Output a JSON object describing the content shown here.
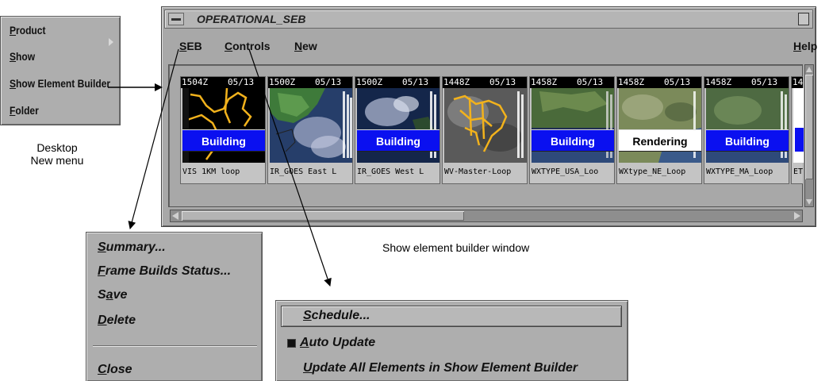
{
  "desktop_menu": {
    "items": [
      {
        "label": "Product",
        "mnemonic": "P",
        "rest": "roduct",
        "has_submenu": true
      },
      {
        "label": "Show",
        "mnemonic": "S",
        "rest": "how"
      },
      {
        "label": "Show Element Builder",
        "mnemonic": "S",
        "rest": "how Element Builder"
      },
      {
        "label": "Folder",
        "mnemonic": "F",
        "rest": "older"
      }
    ],
    "caption_line1": "Desktop",
    "caption_line2": "New menu"
  },
  "seb_window": {
    "title": "OPERATIONAL_SEB",
    "menubar": [
      {
        "label": "SEB",
        "mnemonic": "S",
        "rest": "EB"
      },
      {
        "label": "Controls",
        "mnemonic": "C",
        "rest": "ontrols"
      },
      {
        "label": "New",
        "mnemonic": "N",
        "rest": "ew"
      },
      {
        "label": "Help",
        "mnemonic": "H",
        "rest": "elp"
      }
    ],
    "elements": [
      {
        "time": "1504Z",
        "date": "05/13",
        "status": "Building",
        "name": "VIS 1KM  loop"
      },
      {
        "time": "1500Z",
        "date": "05/13",
        "status": "",
        "name": "IR_GOES East L"
      },
      {
        "time": "1500Z",
        "date": "05/13",
        "status": "Building",
        "name": "IR_GOES West L"
      },
      {
        "time": "1448Z",
        "date": "05/13",
        "status": "",
        "name": "WV-Master-Loop"
      },
      {
        "time": "1458Z",
        "date": "05/13",
        "status": "Building",
        "name": "WXTYPE_USA_Loo"
      },
      {
        "time": "1458Z",
        "date": "05/13",
        "status": "Rendering",
        "name": "WXtype_NE_Loop"
      },
      {
        "time": "1458Z",
        "date": "05/13",
        "status": "Building",
        "name": "WXTYPE_MA_Loop"
      },
      {
        "time": "14",
        "date": "",
        "status": "",
        "name": "ET"
      }
    ],
    "caption": "Show element builder window"
  },
  "seb_menu": {
    "items": [
      {
        "label": "Summary...",
        "mnemonic": "S",
        "rest": "ummary..."
      },
      {
        "label": "Frame Builds Status...",
        "mnemonic": "F",
        "rest": "rame Builds Status..."
      },
      {
        "label": "Save",
        "prefix": "S",
        "mnemonic": "a",
        "rest": "ve"
      },
      {
        "label": "Delete",
        "mnemonic": "D",
        "rest": "elete"
      },
      {
        "label": "Close",
        "mnemonic": "C",
        "rest": "lose"
      }
    ]
  },
  "controls_menu": {
    "items": [
      {
        "label": "Schedule...",
        "mnemonic": "S",
        "rest": "chedule..."
      },
      {
        "label": "Auto Update",
        "mnemonic": "A",
        "rest": "uto Update",
        "checked": true
      },
      {
        "label": "Update All Elements in Show Element Builder",
        "mnemonic": "U",
        "rest": "pdate All Elements in Show Element Builder"
      }
    ]
  },
  "colors": {
    "building": "#0a10f0",
    "rendering": "#ffffff",
    "map_outline": "#f2b21c"
  }
}
